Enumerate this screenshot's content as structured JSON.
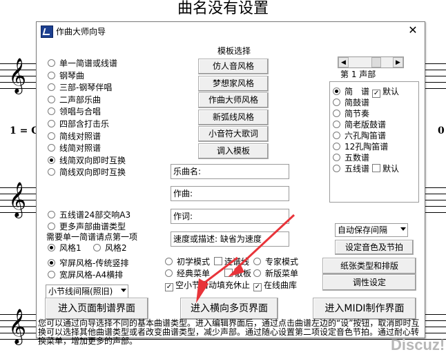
{
  "background": {
    "title": "曲名没有设置",
    "tempo": "1 = C",
    "right_number": "0"
  },
  "window": {
    "title": "作曲大师向导",
    "close_label": "✕"
  },
  "score_types": [
    {
      "label": "单一简谱或线谱",
      "checked": false
    },
    {
      "label": "钢琴曲",
      "checked": false
    },
    {
      "label": "三部-钢琴伴唱",
      "checked": false
    },
    {
      "label": "二声部乐曲",
      "checked": false
    },
    {
      "label": "领唱与合唱",
      "checked": false
    },
    {
      "label": "四部含打击乐",
      "checked": false
    },
    {
      "label": "简线对照谱",
      "checked": false
    },
    {
      "label": "线简对照谱",
      "checked": false
    },
    {
      "label": "线简双向即时互换",
      "checked": true
    },
    {
      "label": "简线双向即时互换",
      "checked": false
    }
  ],
  "score_types_b": [
    {
      "label": "五线谱24部交响A3",
      "checked": false
    },
    {
      "label": "更多声部曲谱类型",
      "checked": false
    }
  ],
  "style_note": "需要单一简谱请点第一项",
  "style_options": [
    {
      "label": "风格1",
      "checked": true
    },
    {
      "label": "风格2",
      "checked": false
    }
  ],
  "screen_options": [
    {
      "label": "窄屏风格-传统竖排",
      "checked": true
    },
    {
      "label": "宽屏风格-A4横排",
      "checked": false
    }
  ],
  "bar_spacing": "小节线间隔(照旧)",
  "template": {
    "heading": "模板选择",
    "buttons": [
      "仿人音风格",
      "梦想家风格",
      "作曲大师风格",
      "新弧线风格",
      "小音符大歌词",
      "调入模板"
    ]
  },
  "fields": {
    "song_name": "乐曲名:",
    "composer": "作曲:",
    "lyricist": "作词:",
    "tempo_desc": "速度或描述: 缺省为速度"
  },
  "modes": [
    {
      "label": "初学模式",
      "checked": false
    },
    {
      "label": "专家模式",
      "checked": false
    },
    {
      "label": "经典菜单",
      "checked": false
    },
    {
      "label": "新版菜单",
      "checked": false
    }
  ],
  "checks": {
    "connect_line": {
      "label": "连谱线",
      "checked": false
    },
    "loose": {
      "label": "散板",
      "checked": false
    },
    "auto_fill": {
      "label": "空小节自动填充休止",
      "checked": true
    },
    "online_lib": {
      "label": "在线曲库",
      "checked": true
    }
  },
  "voice": {
    "part_label": "第 1 声部",
    "items": [
      {
        "label": "简　谱",
        "checked": true,
        "extra": "默认",
        "extra_checked": true
      },
      {
        "label": "简鼓谱",
        "checked": false
      },
      {
        "label": "简节奏",
        "checked": false
      },
      {
        "label": "简老版鼓谱",
        "checked": false
      },
      {
        "label": "六孔陶笛谱",
        "checked": false
      },
      {
        "label": "12孔陶笛谱",
        "checked": false
      },
      {
        "label": "五数谱",
        "checked": false
      },
      {
        "label": "五线谱",
        "checked": false,
        "extra": "默认",
        "extra_checked": false
      }
    ]
  },
  "right_controls": {
    "autosave": "自动保存间隔",
    "set_timbre": "设定音色及节拍",
    "paper": "纸张类型和排版",
    "tune": "调性设定"
  },
  "bottom_buttons": {
    "page_mode": "进入页面制谱界面",
    "horizontal_mode": "进入横向多页界面",
    "midi_mode": "进入MIDI制作界面"
  },
  "hint": "您可以通过向导选择不同的基本曲谱类型。进入编辑界面后，通过点击曲谱左边的“设”按钮，取消即时互换可以选择其他曲谱类型或者改变曲谱类型，减少声部。通过随心设置第二项设定音色节拍。通过耐心转换菜单，增加更多的声部。",
  "watermark": "Discuz!",
  "colors": {
    "arrow": "#e8343a",
    "titlebar": "#ffffff",
    "button_face": "#efefef"
  }
}
